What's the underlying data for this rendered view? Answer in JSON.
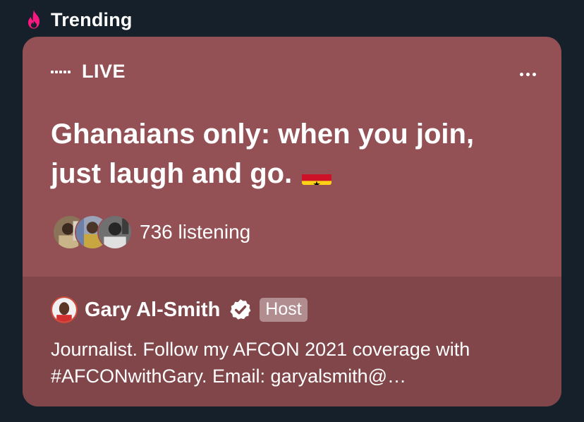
{
  "section": {
    "title": "Trending",
    "icon": "fire-icon"
  },
  "space": {
    "status": "LIVE",
    "title": "Ghanaians only: when you join, just laugh and go.",
    "flag_icon": "ghana-flag-icon",
    "listeners_count_label": "736 listening",
    "listener_avatars": [
      "listener-avatar",
      "listener-avatar",
      "listener-avatar"
    ],
    "more_icon": "more-options-icon"
  },
  "host": {
    "name": "Gary Al-Smith",
    "verified": true,
    "badge": "Host",
    "bio": "Journalist. Follow my AFCON 2021 coverage with #AFCONwithGary. Email: garyalsmith@…"
  },
  "colors": {
    "page_background": "#15202b",
    "card_background": "#935155",
    "card_footer_background": "#804649",
    "badge_background": "#b18d90",
    "fire_icon": "#f91880"
  }
}
